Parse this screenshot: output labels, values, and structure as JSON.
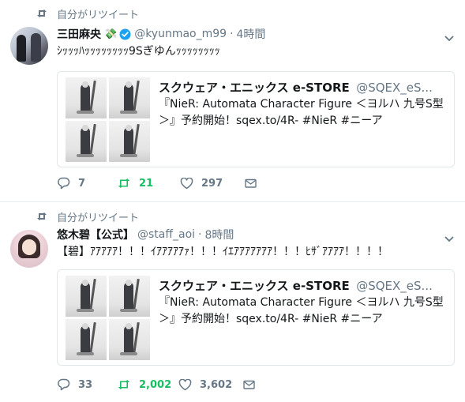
{
  "tweets": [
    {
      "retweet_context": "自分がリツイート",
      "author": {
        "display_name": "三田麻央",
        "name_emoji": "💸",
        "verified": true,
        "screen_name": "@kyunmao_m99",
        "time": "4時間"
      },
      "text": "ｼｯｯｯﾊｯｯｯｯｯｯｯｯ9Sぎゆんｯｯｯｯｯｯｯｯ",
      "quote": {
        "display_name": "スクウェア・エニックス e-STORE",
        "screen_name": "@SQEX_eS...",
        "text": "『NieR: Automata Character Figure ＜ヨルハ 九号S型＞』予約開始！sqex.to/4R- #NieR #ニーア"
      },
      "actions": {
        "replies": "7",
        "retweets": "21",
        "likes": "297"
      }
    },
    {
      "retweet_context": "自分がリツイート",
      "author": {
        "display_name": "悠木碧【公式】",
        "screen_name": "@staff_aoi",
        "time": "8時間"
      },
      "text": "【碧】ｱｱｱｱｱ！！！ｲｱｱｱｱｱｧ！！！ｲｴｱｱｱｱｱｱｱ！！！ﾋｻﾞｱｱｱｱ！！！！",
      "quote": {
        "display_name": "スクウェア・エニックス e-STORE",
        "screen_name": "@SQEX_eS...",
        "text": "『NieR: Automata Character Figure ＜ヨルハ 九号S型＞』予約開始！sqex.to/4R- #NieR #ニーア"
      },
      "actions": {
        "replies": "33",
        "retweets": "2,002",
        "likes": "3,602"
      }
    }
  ],
  "icons": {
    "retweet_context": "retweet-icon",
    "verified": "verified-badge-icon",
    "caret": "chevron-down-icon",
    "reply": "reply-icon",
    "retweet": "retweet-icon",
    "like": "heart-icon",
    "dm": "envelope-icon"
  },
  "colors": {
    "text": "#14171a",
    "secondary": "#657786",
    "retweet_active": "#17bf63",
    "verified": "#1da1f2",
    "border": "#e1e8ed"
  }
}
